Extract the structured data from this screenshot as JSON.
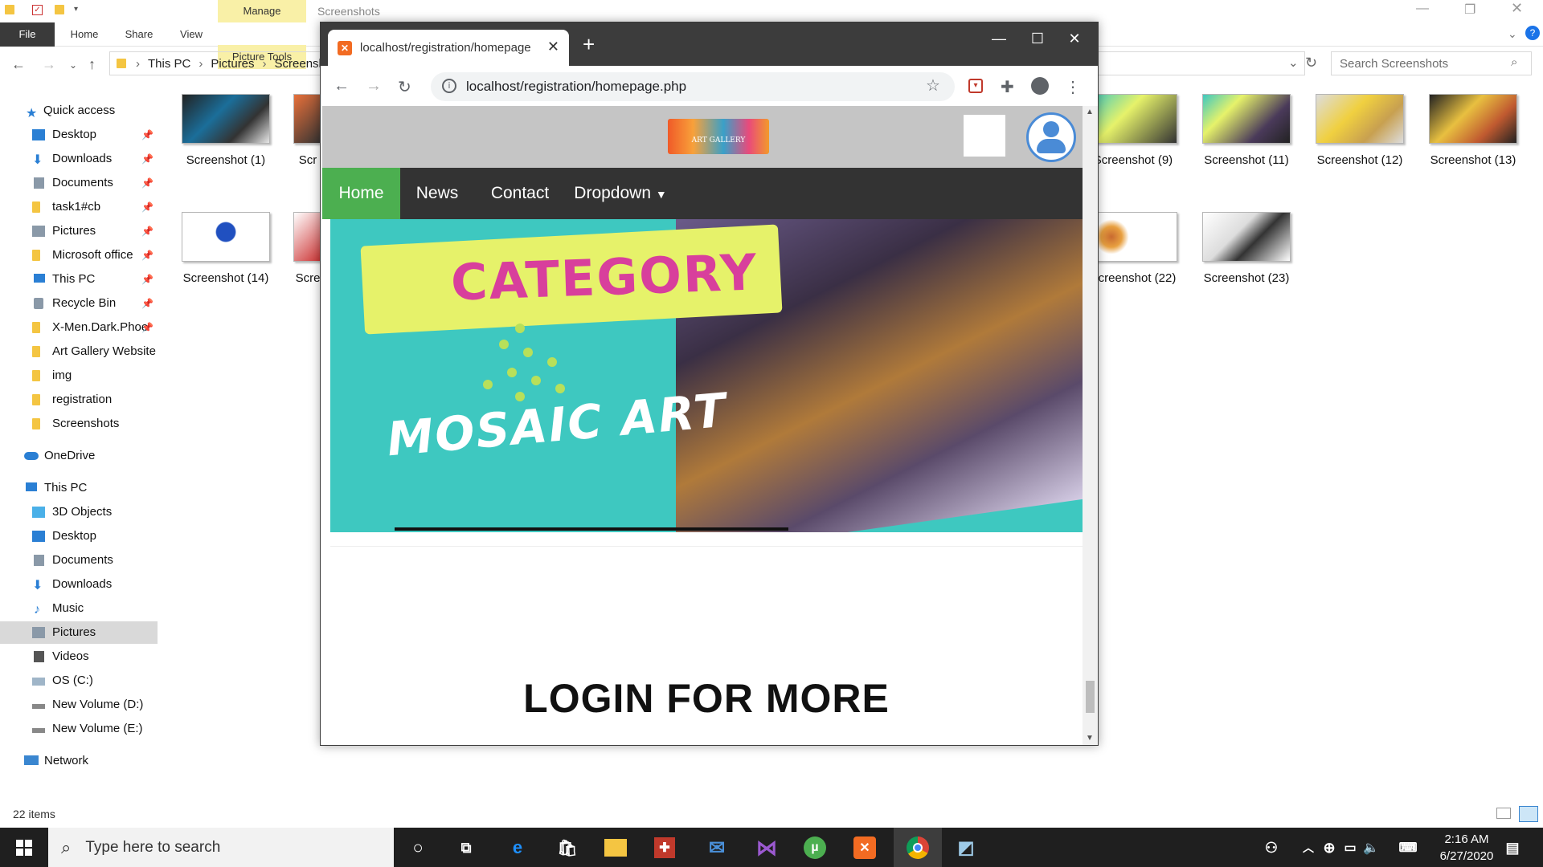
{
  "explorer": {
    "ribbon": {
      "manage_label": "Manage",
      "context_title": "Screenshots",
      "tabs": [
        "File",
        "Home",
        "Share",
        "View",
        "Picture Tools"
      ]
    },
    "breadcrumb": [
      "This PC",
      "Pictures",
      "Screenshots"
    ],
    "search_placeholder": "Search Screenshots",
    "nav": {
      "quick_access_label": "Quick access",
      "quick_access": [
        "Desktop",
        "Downloads",
        "Documents",
        "task1#cb",
        "Pictures",
        "Microsoft office",
        "This PC",
        "Recycle Bin",
        "X-Men.Dark.Phoe"
      ],
      "folders": [
        "Art Gallery Website",
        "img",
        "registration",
        "Screenshots"
      ],
      "onedrive": "OneDrive",
      "this_pc_label": "This PC",
      "this_pc": [
        "3D Objects",
        "Desktop",
        "Documents",
        "Downloads",
        "Music",
        "Pictures",
        "Videos",
        "OS (C:)",
        "New Volume (D:)",
        "New Volume (E:)"
      ],
      "network": "Network"
    },
    "thumbnails": [
      "Screenshot (1)",
      "Scr",
      "Screenshot (9)",
      "Screenshot (11)",
      "Screenshot (12)",
      "Screenshot (13)",
      "Screenshot (14)",
      "Scre",
      "Screenshot (22)",
      "Screenshot (23)"
    ],
    "status": "22 items"
  },
  "browser": {
    "tab_title": "localhost/registration/homepage",
    "url": "localhost/registration/homepage.php",
    "site": {
      "logo_text": "ART GALLERY",
      "nav": [
        "Home",
        "News",
        "Contact",
        "Dropdown"
      ],
      "banner_title": "CATEGORY",
      "banner_subtitle": "MOSAIC ART",
      "heading": "LOGIN FOR MORE"
    }
  },
  "taskbar": {
    "search_placeholder": "Type here to search",
    "time": "2:16 AM",
    "date": "6/27/2020"
  },
  "colors": {
    "nav_active": "#4caf50",
    "nav_bg": "#333333",
    "banner_bg": "#3ec8c0",
    "category_text": "#d83f9c"
  }
}
